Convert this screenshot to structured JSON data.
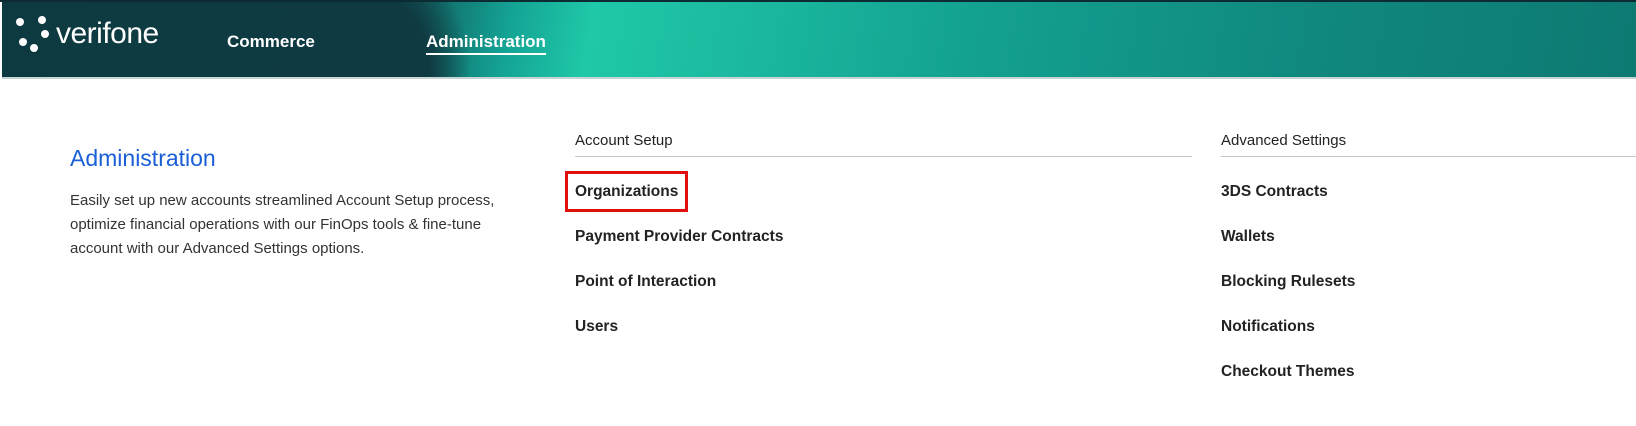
{
  "header": {
    "logo_text": "verifone",
    "nav": [
      {
        "label": "Commerce",
        "active": false
      },
      {
        "label": "Administration",
        "active": true
      }
    ]
  },
  "intro": {
    "title": "Administration",
    "description": "Easily set up new accounts streamlined Account Setup process, optimize financial operations with our FinOps tools & fine-tune account with our Advanced Settings options."
  },
  "account_setup": {
    "heading": "Account Setup",
    "items": [
      "Organizations",
      "Payment Provider Contracts",
      "Point of Interaction",
      "Users"
    ]
  },
  "advanced_settings": {
    "heading": "Advanced Settings",
    "items": [
      "3DS Contracts",
      "Wallets",
      "Blocking Rulesets",
      "Notifications",
      "Checkout Themes"
    ]
  },
  "colors": {
    "accent": "#1a5fd6",
    "highlight_box": "#e01010"
  }
}
